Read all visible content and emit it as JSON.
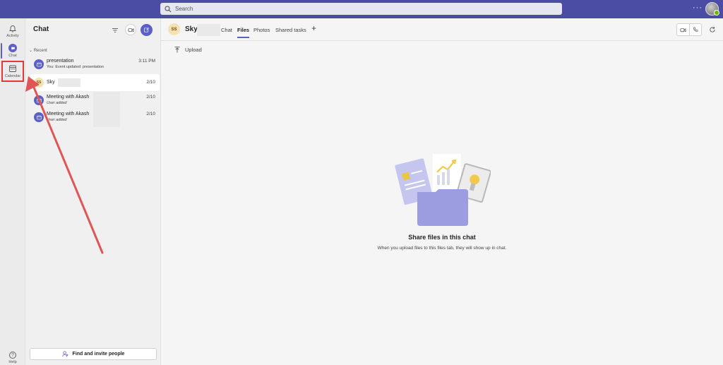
{
  "topbar": {
    "search_placeholder": "Search",
    "more_label": "···"
  },
  "rail": {
    "items": [
      {
        "label": "Activity",
        "icon": "bell-icon"
      },
      {
        "label": "Chat",
        "icon": "chat-icon"
      },
      {
        "label": "Calendar",
        "icon": "calendar-icon"
      }
    ],
    "help_label": "Help"
  },
  "chat_panel": {
    "title": "Chat",
    "section": "Recent",
    "items": [
      {
        "name": "presentation",
        "subtitle": "You: Event updated: presentation",
        "time": "3:11 PM"
      },
      {
        "name": "Sky",
        "subtitle": "",
        "time": "2/10",
        "initials": "SS"
      },
      {
        "name": "Meeting with Akash",
        "subtitle": "User added",
        "time": "2/10"
      },
      {
        "name": "Meeting with Akash",
        "subtitle": "User added",
        "time": "2/10"
      }
    ],
    "find_button": "Find and invite people"
  },
  "main": {
    "avatar_initials": "SS",
    "title": "Sky",
    "tabs": [
      "Chat",
      "Files",
      "Photos",
      "Shared tasks"
    ],
    "active_tab": "Files",
    "upload_label": "Upload",
    "empty_title": "Share files in this chat",
    "empty_subtitle": "When you upload files to this files tab, they will show up in chat."
  },
  "colors": {
    "brand": "#4b4ca3",
    "accent": "#5b5fc7",
    "annotation": "#e03a3a"
  }
}
